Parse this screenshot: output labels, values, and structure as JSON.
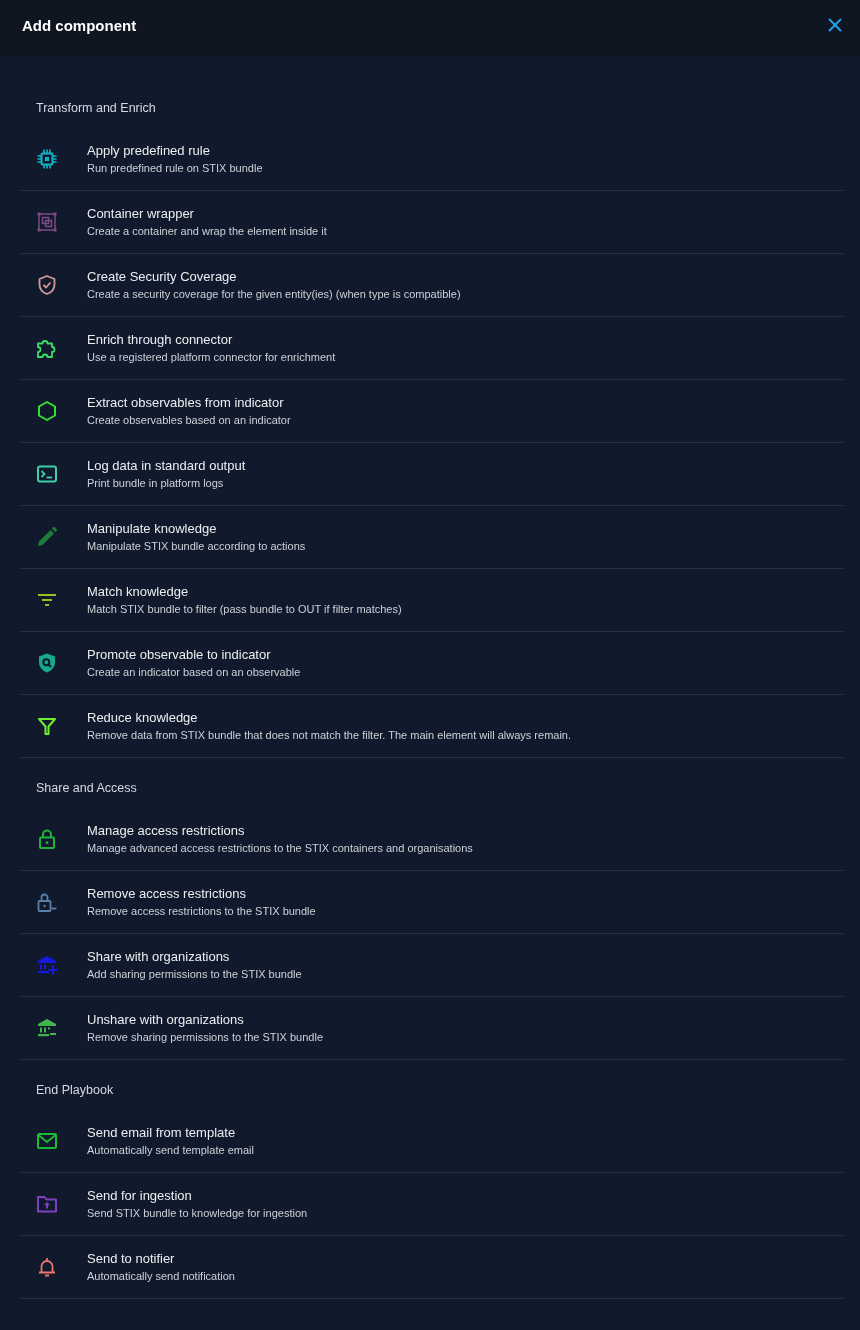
{
  "header": {
    "title": "Add component"
  },
  "sections": [
    {
      "heading": "Transform and Enrich",
      "items": [
        {
          "title": "Apply predefined rule",
          "description": "Run predefined rule on STIX bundle",
          "color": "#0fb4c6"
        },
        {
          "title": "Container wrapper",
          "description": "Create a container and wrap the element inside it",
          "color": "#7d4a86"
        },
        {
          "title": "Create Security Coverage",
          "description": "Create a security coverage for the given entity(ies) (when type is compatible)",
          "color": "#d49a9c"
        },
        {
          "title": "Enrich through connector",
          "description": "Use a registered platform connector for enrichment",
          "color": "#3ddc68"
        },
        {
          "title": "Extract observables from indicator",
          "description": "Create observables based on an indicator",
          "color": "#2ee32e"
        },
        {
          "title": "Log data in standard output",
          "description": "Print bundle in platform logs",
          "color": "#3fd0a6"
        },
        {
          "title": "Manipulate knowledge",
          "description": "Manipulate STIX bundle according to actions",
          "color": "#1f7a3c"
        },
        {
          "title": "Match knowledge",
          "description": "Match STIX bundle to filter (pass bundle to OUT if filter matches)",
          "color": "#8fc41a"
        },
        {
          "title": "Promote observable to indicator",
          "description": "Create an indicator based on an observable",
          "color": "#16a98a"
        },
        {
          "title": "Reduce knowledge",
          "description": "Remove data from STIX bundle that does not match the filter. The main element will always remain.",
          "color": "#6cf02e"
        }
      ]
    },
    {
      "heading": "Share and Access",
      "items": [
        {
          "title": "Manage access restrictions",
          "description": "Manage advanced access restrictions to the STIX containers and organisations",
          "color": "#22b23c"
        },
        {
          "title": "Remove access restrictions",
          "description": "Remove access restrictions to the STIX bundle",
          "color": "#5a7fa8"
        },
        {
          "title": "Share with organizations",
          "description": "Add sharing permissions to the STIX bundle",
          "color": "#1818e0"
        },
        {
          "title": "Unshare with organizations",
          "description": "Remove sharing permissions to the STIX bundle",
          "color": "#41b54b"
        }
      ]
    },
    {
      "heading": "End Playbook",
      "items": [
        {
          "title": "Send email from template",
          "description": "Automatically send template email",
          "color": "#1db930"
        },
        {
          "title": "Send for ingestion",
          "description": "Send STIX bundle to knowledge for ingestion",
          "color": "#7f40bf"
        },
        {
          "title": "Send to notifier",
          "description": "Automatically send notification",
          "color": "#e8766a"
        }
      ]
    }
  ]
}
